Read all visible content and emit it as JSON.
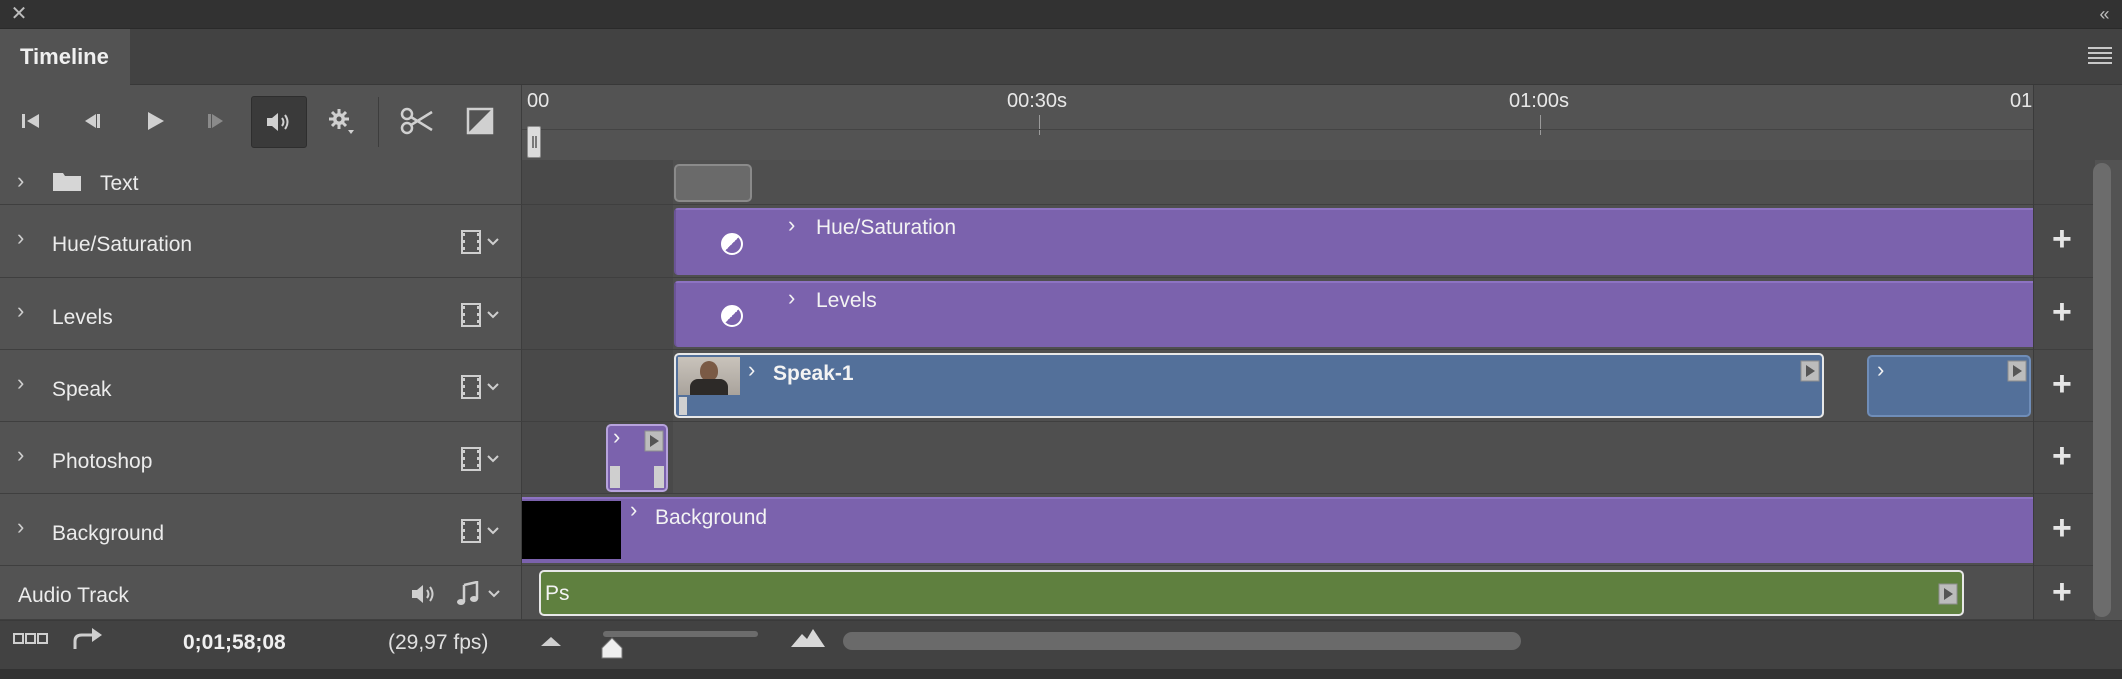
{
  "window": {
    "close_glyph": "✕",
    "collapse_glyph": "«"
  },
  "panel": {
    "tab_title": "Timeline"
  },
  "ruler": {
    "labels": [
      "00",
      "00:30s",
      "01:00s",
      "01"
    ]
  },
  "tracks": [
    {
      "name": "Text",
      "type": "group"
    },
    {
      "name": "Hue/Saturation",
      "type": "adjustment"
    },
    {
      "name": "Levels",
      "type": "adjustment"
    },
    {
      "name": "Speak",
      "type": "video"
    },
    {
      "name": "Photoshop",
      "type": "video"
    },
    {
      "name": "Background",
      "type": "video"
    }
  ],
  "clips": {
    "hue": "Hue/Saturation",
    "levels": "Levels",
    "speak": "Speak-1",
    "background": "Background",
    "audio": "Ps"
  },
  "audio_track": {
    "name": "Audio Track"
  },
  "footer": {
    "timecode": "0;01;58;08",
    "fps": "(29,97 fps)"
  },
  "colors": {
    "adjustment_clip": "#7b62ad",
    "video_clip": "#53709a",
    "audio_clip": "#5f803f",
    "panel_bg": "#535353"
  },
  "icons": {
    "toolbar": [
      "go-to-first-frame-icon",
      "previous-frame-icon",
      "play-icon",
      "next-frame-icon",
      "audio-icon",
      "gear-icon",
      "scissors-icon",
      "transition-icon"
    ],
    "track": [
      "film-strip-icon",
      "chevron-down-icon"
    ],
    "footer": [
      "convert-frame-animation-icon",
      "render-video-icon",
      "zoom-out-icon",
      "zoom-in-icon"
    ]
  }
}
